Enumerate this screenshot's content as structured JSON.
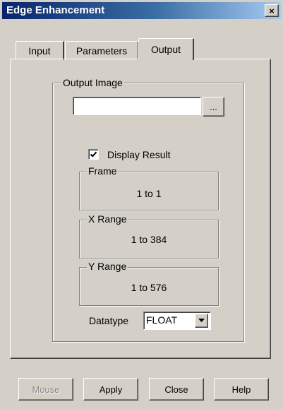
{
  "window": {
    "title": "Edge Enhancement",
    "close_label": "×"
  },
  "tabs": [
    {
      "label": "Input",
      "active": false
    },
    {
      "label": "Parameters",
      "active": false
    },
    {
      "label": "Output",
      "active": true
    }
  ],
  "output": {
    "output_image": {
      "label": "Output Image",
      "value": "",
      "browse_label": "..."
    },
    "display_result": {
      "label": "Display Result",
      "checked": true
    },
    "frame": {
      "label": "Frame",
      "value": "1 to 1"
    },
    "x_range": {
      "label": "X Range",
      "value": "1 to 384"
    },
    "y_range": {
      "label": "Y Range",
      "value": "1 to 576"
    },
    "datatype": {
      "label": "Datatype",
      "selected": "FLOAT"
    }
  },
  "buttons": {
    "mouse": {
      "label": "Mouse",
      "enabled": false
    },
    "apply": {
      "label": "Apply"
    },
    "close": {
      "label": "Close"
    },
    "help": {
      "label": "Help"
    }
  }
}
